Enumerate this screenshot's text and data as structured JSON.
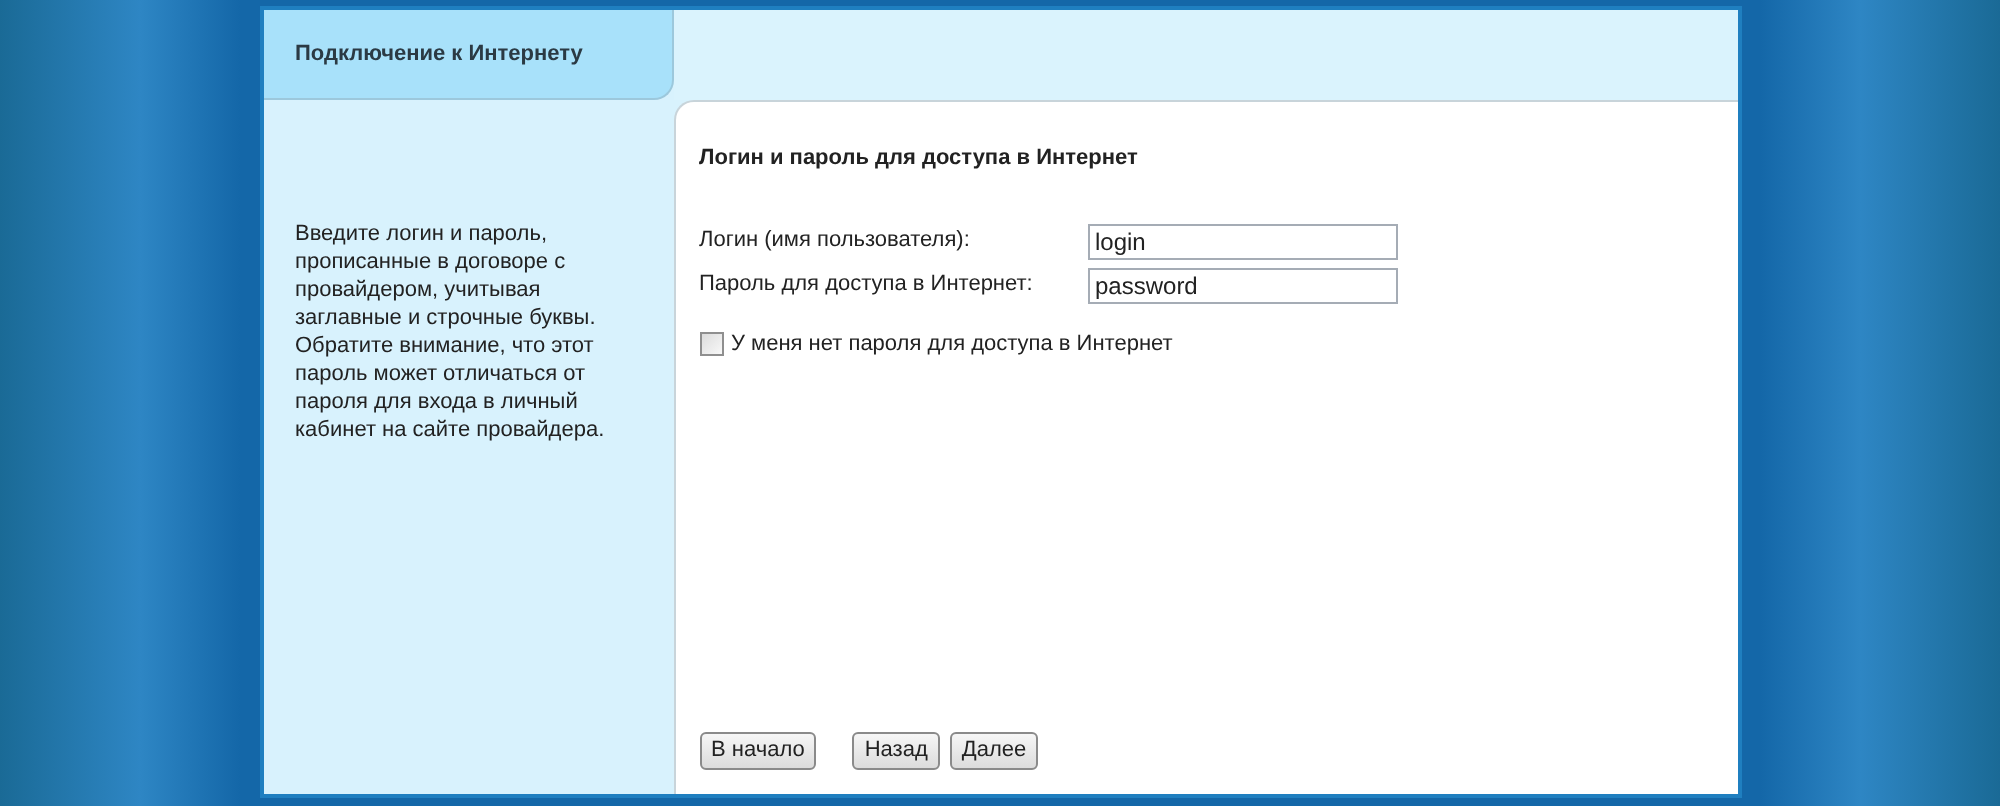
{
  "tab": {
    "label": "Подключение к Интернету",
    "selected": true
  },
  "sidebar": {
    "text": "Введите логин и пароль, прописанные в договоре с провайдером, учитывая заглавные и строчные буквы. Обратите внимание, что этот пароль может отличаться от пароля для входа в личный кабинет на сайте провайдера."
  },
  "content": {
    "title": "Логин и пароль для доступа в Интернет",
    "fields": [
      {
        "label": "Логин (имя пользователя):",
        "value": "login"
      },
      {
        "label": "Пароль для доступа в Интернет:",
        "value": "password"
      }
    ],
    "checkbox": {
      "label": "У меня нет пароля для доступа в Интернет",
      "checked": false
    }
  },
  "button_groups": [
    [
      "В начало"
    ],
    [
      "Назад",
      "Далее"
    ]
  ]
}
